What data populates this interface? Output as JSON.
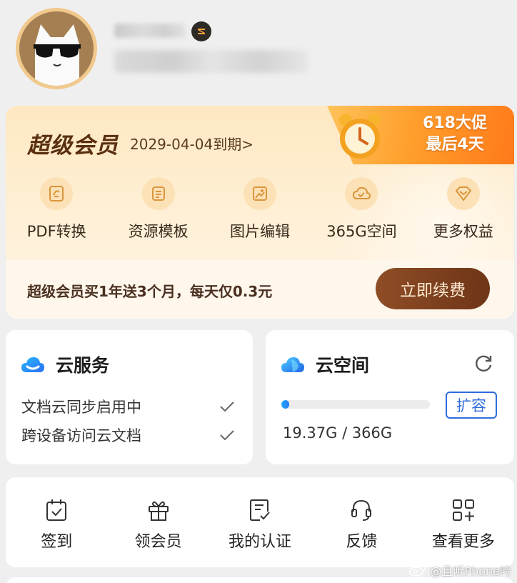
{
  "profile": {
    "avatar_icon": "cat-with-sunglasses",
    "badge_icon": "level-s-badge"
  },
  "vip": {
    "title": "超级会员",
    "expire": "2029-04-04到期>",
    "promo_line1": "618大促",
    "promo_line2": "最后4天",
    "benefits": [
      {
        "label": "PDF转换",
        "icon": "pdf-convert-icon"
      },
      {
        "label": "资源模板",
        "icon": "template-icon"
      },
      {
        "label": "图片编辑",
        "icon": "image-edit-icon"
      },
      {
        "label": "365G空间",
        "icon": "cloud-space-icon"
      },
      {
        "label": "更多权益",
        "icon": "diamond-icon"
      }
    ],
    "renew_text": "超级会员买1年送3个月，每天仅0.3元",
    "renew_button": "立即续费"
  },
  "cloud_service": {
    "title": "云服务",
    "items": [
      "文档云同步启用中",
      "跨设备访问云文档"
    ]
  },
  "cloud_space": {
    "title": "云空间",
    "expand_button": "扩容",
    "usage": "19.37G / 366G",
    "used_fraction": 0.053
  },
  "quick_actions": [
    {
      "label": "签到",
      "icon": "calendar-check-icon"
    },
    {
      "label": "领会员",
      "icon": "gift-icon"
    },
    {
      "label": "我的认证",
      "icon": "certificate-icon"
    },
    {
      "label": "反馈",
      "icon": "headset-icon"
    },
    {
      "label": "查看更多",
      "icon": "grid-plus-icon"
    }
  ],
  "watermark": "@且听Phone吟",
  "colors": {
    "vip_brown": "#5a2f10",
    "accent_blue": "#2f6bde",
    "promo_orange": "#ff9f2c"
  }
}
